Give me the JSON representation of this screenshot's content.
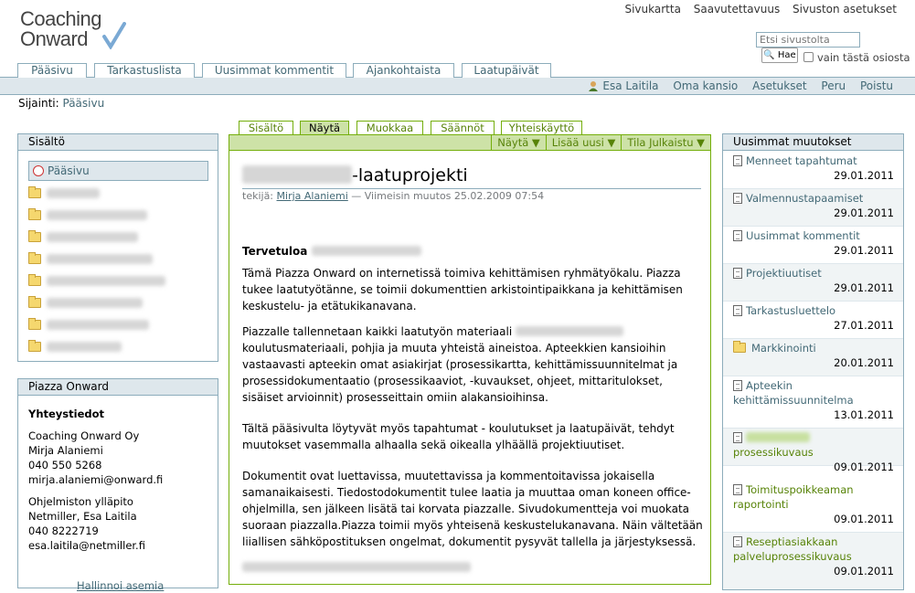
{
  "logo": {
    "line1": "Coaching",
    "line2": "Onward"
  },
  "site_actions": [
    "Sivukartta",
    "Saavutettavuus",
    "Sivuston asetukset"
  ],
  "search": {
    "placeholder": "Etsi sivustolta",
    "button": "Hae",
    "option": "vain tästä osiosta"
  },
  "global_tabs": [
    "Pääsivu",
    "Tarkastuslista",
    "Uusimmat kommentit",
    "Ajankohtaista",
    "Laatupäivät"
  ],
  "personal_bar": [
    "Esa Laitila",
    "Oma kansio",
    "Asetukset",
    "Peru",
    "Poistu"
  ],
  "breadcrumb": {
    "label": "Sijainti:",
    "item": "Pääsivu"
  },
  "nav": {
    "title": "Sisältö",
    "home": "Pääsivu"
  },
  "contact": {
    "title": "Piazza Onward",
    "heading": "Yhteystiedot",
    "lines": [
      "Coaching Onward Oy",
      "Mirja Alaniemi",
      "040 550 5268",
      "mirja.alaniemi@onward.fi",
      "",
      "Ohjelmiston ylläpito",
      "Netmiller, Esa Laitila",
      "040 8222719",
      "esa.laitila@netmiller.fi"
    ],
    "footer": "Hallinnoi asemia"
  },
  "content_tabs": [
    "Sisältö",
    "Näytä",
    "Muokkaa",
    "Säännöt",
    "Yhteiskäyttö"
  ],
  "content_actions": [
    "Näytä ▼",
    "Lisää uusi ▼",
    "Tila Julkaistu ▼"
  ],
  "article": {
    "title_suffix": "-laatuprojekti",
    "byline_prefix": "tekijä:",
    "author": "Mirja Alaniemi",
    "modified": "— Viimeisin muutos 25.02.2009 07:54",
    "heading": "Tervetuloa",
    "p1": "Tämä Piazza Onward on internetissä toimiva kehittämisen ryhmätyökalu. Piazza tukee laatutyötänne, se toimii dokumenttien arkistointipaikkana ja kehittämisen keskustelu- ja etätukikanavana.",
    "p2a": "Piazzalle tallennetaan kaikki laatutyön materiaali",
    "p2b": "koulutusmateriaali, pohjia ja muuta yhteistä aineistoa. Apteekkien kansioihin vastaavasti apteekin omat asiakirjat (prosessikartta, kehittämissuunnitelmat ja prosessidokumentaatio (prosessikaaviot, -kuvaukset, ohjeet, mittaritulokset, sisäiset arvioinnit) prosesseittain omiin alakansioihinsa.",
    "p3": "Tältä pääsivulta löytyvät myös tapahtumat - koulutukset ja laatupäivät, tehdyt muutokset vasemmalla alhaalla sekä oikealla ylhäällä projektiuutiset.",
    "p4": "Dokumentit ovat luettavissa, muutettavissa ja kommentoitavissa jokaisella samanaikaisesti. Tiedostodokumentit tulee laatia ja muuttaa oman koneen office-ohjelmilla, sen jälkeen lisätä tai korvata piazzalle. Sivudokumentteja voi muokata suoraan piazzalla.Piazza toimii myös yhteisenä keskustelukanavana. Näin vältetään liiallisen sähköpostituksen ongelmat, dokumentit pysyvät tallella ja järjestyksessä."
  },
  "recent": {
    "title": "Uusimmat muutokset",
    "items": [
      {
        "label": "Menneet tapahtumat",
        "date": "29.01.2011"
      },
      {
        "label": "Valmennustapaamiset",
        "date": "29.01.2011"
      },
      {
        "label": "Uusimmat kommentit",
        "date": "29.01.2011"
      },
      {
        "label": "Projektiuutiset",
        "date": "29.01.2011"
      },
      {
        "label": "Tarkastusluettelo",
        "date": "27.01.2011"
      },
      {
        "label": "Markkinointi",
        "date": "20.01.2011"
      },
      {
        "label": "Apteekin kehittämissuunnitelma",
        "date": "13.01.2011"
      },
      {
        "label": "prosessikuvaus",
        "date": "09.01.2011"
      },
      {
        "label": "Toimituspoikkeaman raportointi",
        "date": "09.01.2011"
      },
      {
        "label": "Reseptiasiakkaan palveluprosessikuvaus",
        "date": "09.01.2011"
      }
    ]
  },
  "colors": {
    "accent_blue": "#436976",
    "border_blue": "#8cacbb",
    "accent_green": "#74ae0b",
    "green_bg": "#cde2a7",
    "header_bg": "#dee7ec"
  }
}
